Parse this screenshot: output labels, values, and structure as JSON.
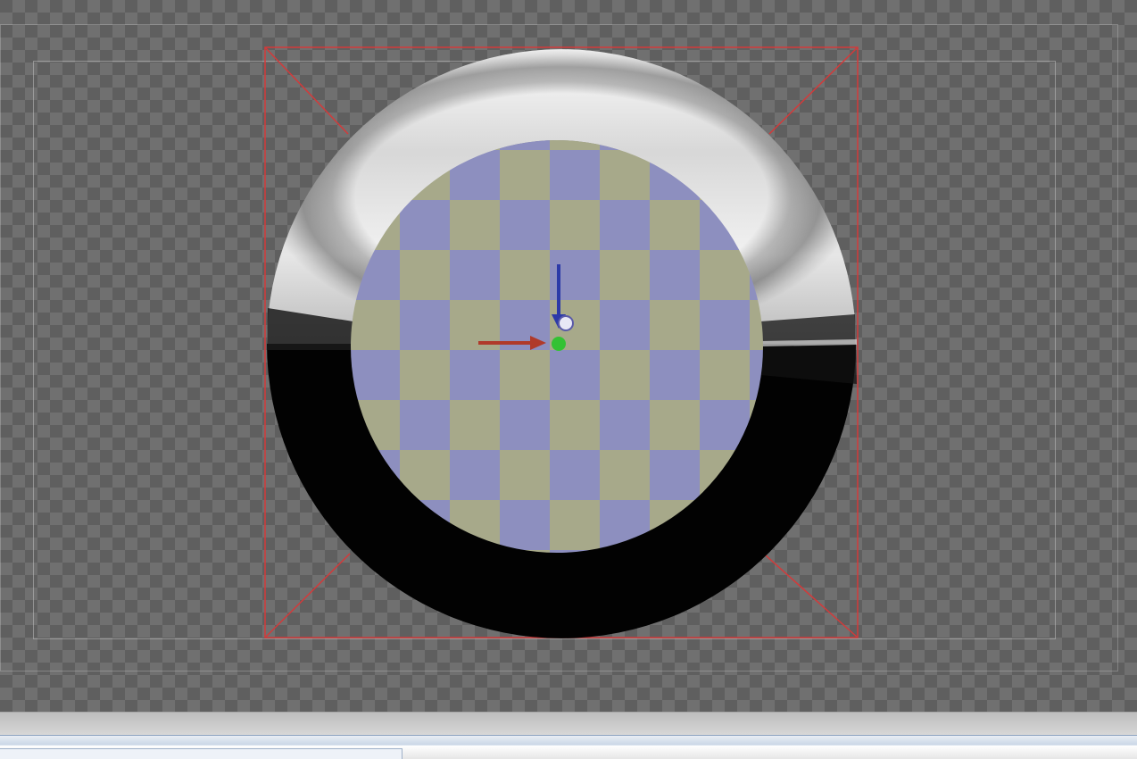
{
  "viewport": {
    "background": "checkerboard-transparency",
    "selection_color": "#d33a3a",
    "object": {
      "type": "ring-with-checker-center",
      "checker_colors": [
        "#8d8fbf",
        "#a7a98a"
      ],
      "ring_upper": "brushed-silver",
      "ring_lower": "black"
    },
    "gizmo": {
      "x_axis_color": "#b03a2a",
      "y_axis_color": "#2c3aa8",
      "pivot_color": "#33c233"
    }
  }
}
